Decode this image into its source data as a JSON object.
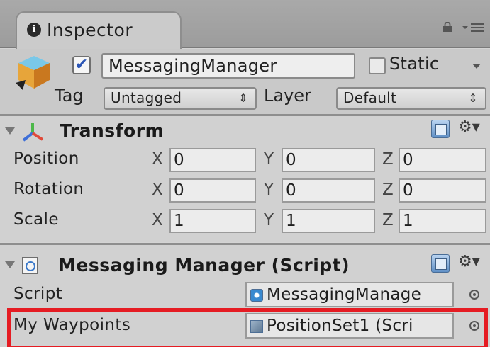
{
  "tab": {
    "title": "Inspector",
    "info_glyph": "i",
    "icons": [
      "info-icon",
      "lock-icon",
      "tab-menu-icon"
    ]
  },
  "header": {
    "name": "MessagingManager",
    "active_checked": true,
    "static_label": "Static",
    "static_checked": false,
    "tag_label": "Tag",
    "tag_value": "Untagged",
    "layer_label": "Layer",
    "layer_value": "Default",
    "updown_glyph": "⇕"
  },
  "transform": {
    "title": "Transform",
    "rows": [
      {
        "label": "Position",
        "x": "0",
        "y": "0",
        "z": "0"
      },
      {
        "label": "Rotation",
        "x": "0",
        "y": "0",
        "z": "0"
      },
      {
        "label": "Scale",
        "x": "1",
        "y": "1",
        "z": "1"
      }
    ],
    "axis_labels": {
      "x": "X",
      "y": "Y",
      "z": "Z"
    }
  },
  "script_component": {
    "title": "Messaging Manager (Script)",
    "fields": [
      {
        "label": "Script",
        "value": "MessagingManage"
      },
      {
        "label": "My Waypoints",
        "value": "PositionSet1 (Scri"
      }
    ]
  },
  "gear_glyph": "⚙▾",
  "colors": {
    "highlight": "#e51c23",
    "checkbox_check": "#2b55b5",
    "panel_bg": "#d1d1d1",
    "tab_bar": "#a3a3a3"
  }
}
